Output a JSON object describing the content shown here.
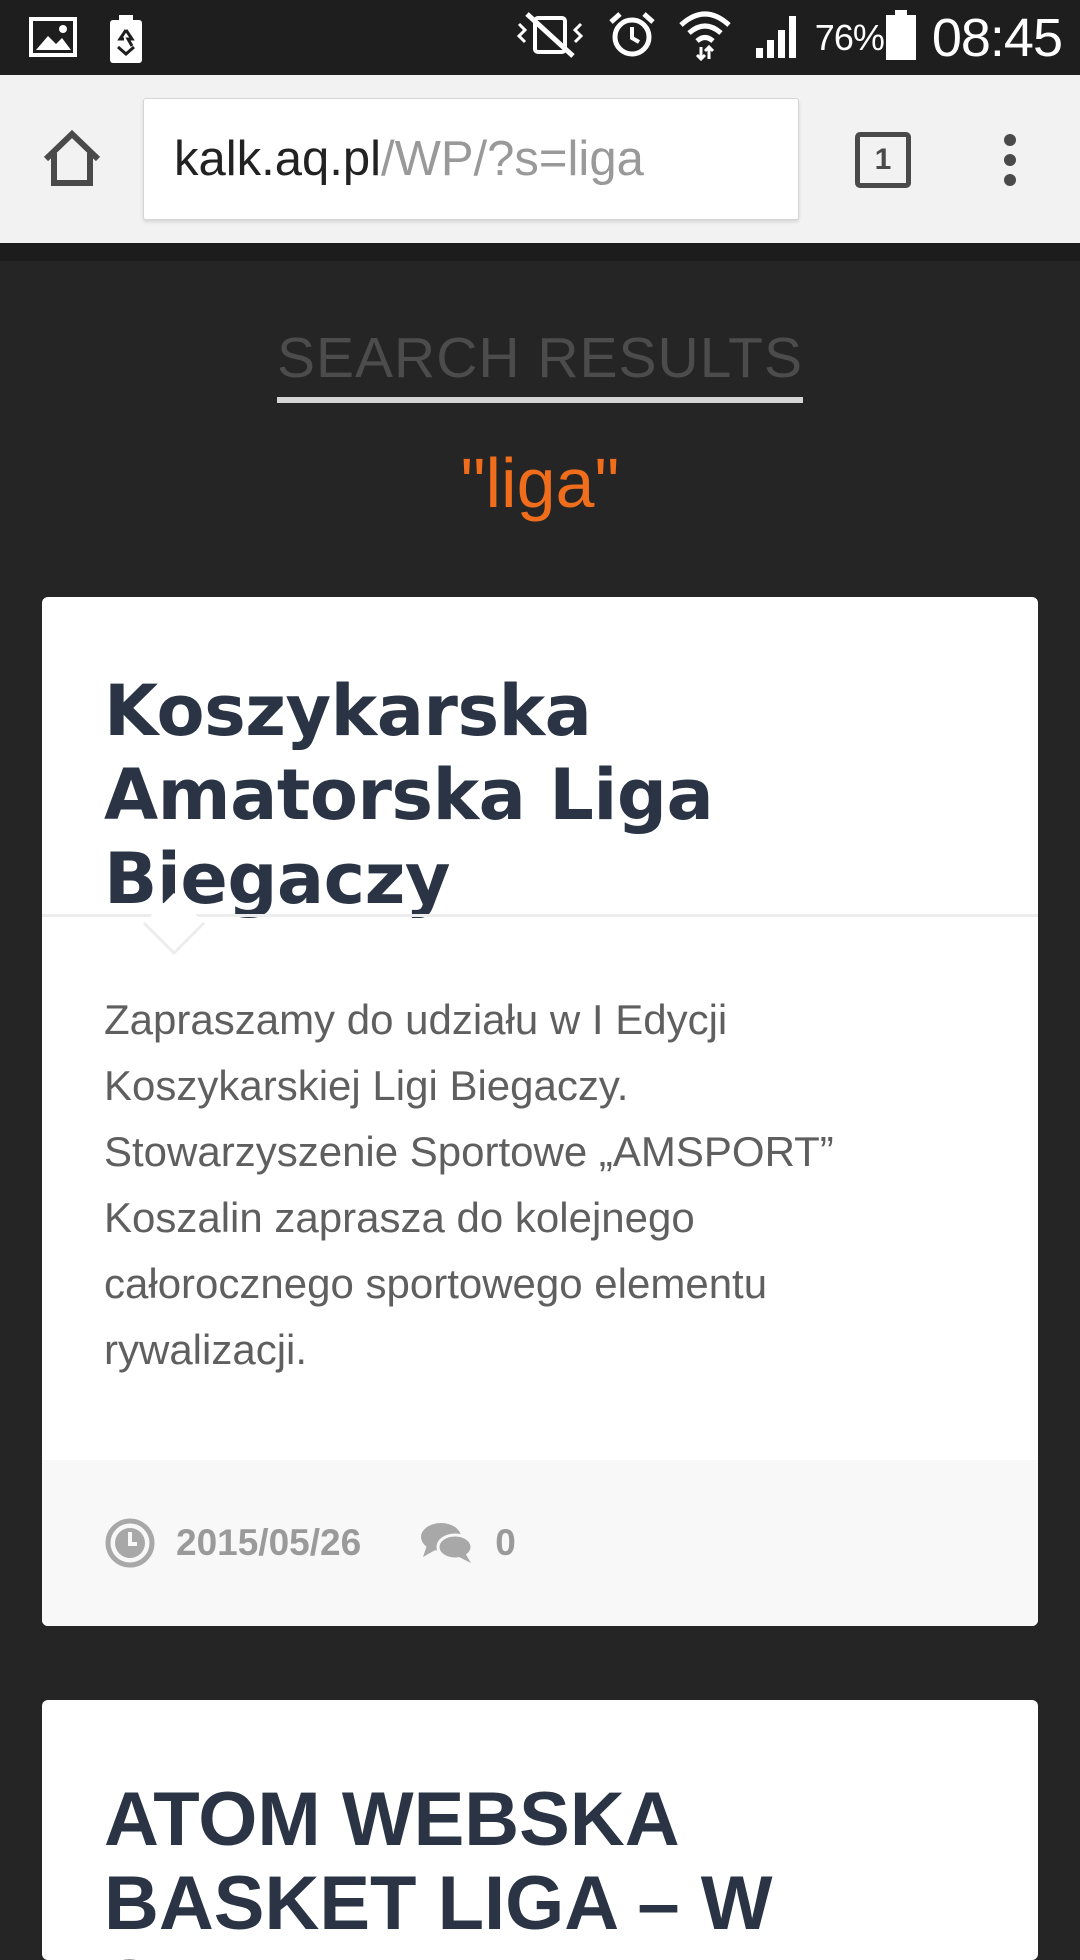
{
  "status_bar": {
    "battery_percent": "76%",
    "time": "08:45",
    "icons": [
      "gallery-icon",
      "battery-saver-icon",
      "vibrate-off-icon",
      "alarm-icon",
      "wifi-icon",
      "signal-icon",
      "battery-icon"
    ]
  },
  "browser": {
    "url_host": "kalk.aq.pl",
    "url_path": "/WP/?s=liga",
    "tab_count": "1",
    "icons": [
      "home-icon",
      "tabs-icon",
      "overflow-menu-icon"
    ]
  },
  "page": {
    "heading": "SEARCH RESULTS",
    "search_term": "\"liga\"",
    "accent_color": "#f06d1c",
    "results": [
      {
        "title": "Koszykarska Amatorska Liga Biegaczy",
        "excerpt": "Zapraszamy do udziału w I Edycji Koszykarskiej Ligi Biegaczy. Stowarzyszenie Sportowe „AMSPORT” Koszalin zaprasza do kolejnego całorocznego sportowego elementu rywalizacji.",
        "date": "2015/05/26",
        "comments": "0"
      },
      {
        "title": "ATOM WEBSKA BASKET LIGA – W SUPER"
      }
    ]
  }
}
